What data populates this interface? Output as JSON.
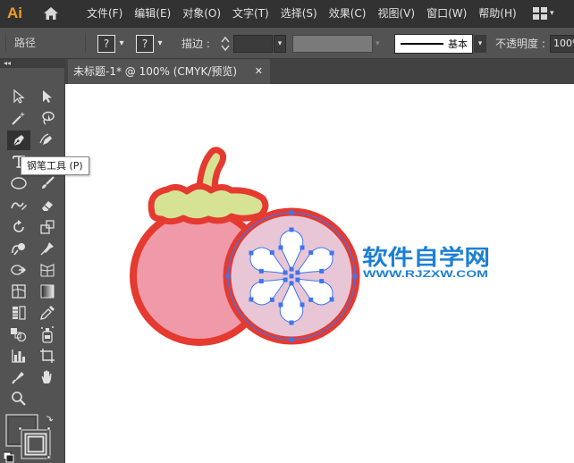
{
  "app": {
    "logo": "Ai",
    "accent": "#f29a2e"
  },
  "menu": [
    "文件(F)",
    "编辑(E)",
    "对象(O)",
    "文字(T)",
    "选择(S)",
    "效果(C)",
    "视图(V)",
    "窗口(W)",
    "帮助(H)"
  ],
  "control": {
    "selection_label": "路径",
    "fill_value": "?",
    "stroke_value": "?",
    "stroke_label": "描边 :",
    "brush_label": "基本",
    "opacity_label": "不透明度 :",
    "opacity_value": "100%"
  },
  "toolbar": {
    "collapse_label": "◂◂",
    "selected_tool": "pen-tool",
    "tooltip": "钢笔工具 (P)"
  },
  "document": {
    "tab_title": "未标题-1* @ 100% (CMYK/预览)",
    "close_label": "✕"
  },
  "artwork": {
    "colors": {
      "outline": "#e53a30",
      "body": "#f09aa9",
      "calyx": "#d6e395",
      "slice": "#e8c6d6",
      "segment": "#ffffff",
      "anchor": "#3f74ee"
    }
  },
  "watermark": {
    "title": "软件自学网",
    "url": "WWW.RJZXW.COM",
    "color": "#1c7fd6"
  }
}
